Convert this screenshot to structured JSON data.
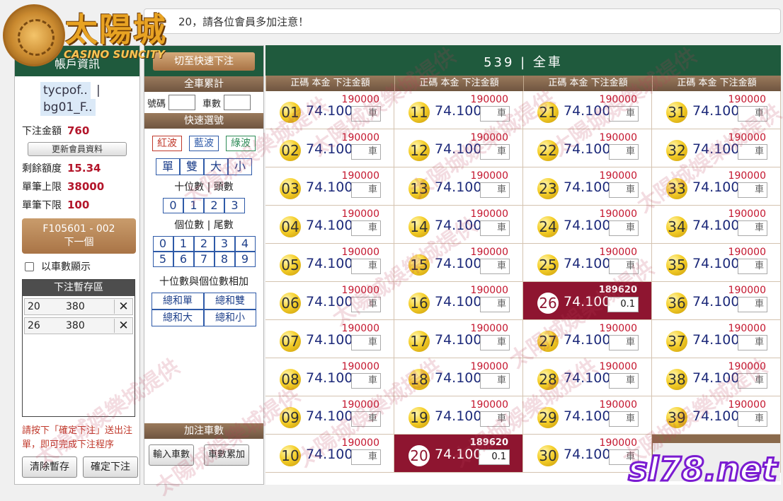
{
  "marquee": {
    "text": "20，請各位會員多加注意！"
  },
  "logo": {
    "title": "太陽城",
    "subtitle": "CASINO SUNCITY"
  },
  "account": {
    "header": "帳戶資訊",
    "user": "tycpof..",
    "sub": "bg01_F..",
    "bet_amount_label": "下注金額",
    "bet_amount": "760",
    "update_button": "更新會員資料",
    "balance_label": "剩餘額度",
    "balance": "15.34",
    "max_label": "單筆上限",
    "max": "38000",
    "min_label": "單筆下限",
    "min": "100",
    "next_button_line1": "F105601 - 002",
    "next_button_line2": "下一個",
    "show_by_car": "以車數顯示",
    "temp_header": "下注暫存區",
    "temp_items": [
      {
        "num": "20",
        "amount": "380"
      },
      {
        "num": "26",
        "amount": "380"
      }
    ],
    "note": "請按下「確定下注」送出注單，即可完成下注程序",
    "clear_button": "清除暫存",
    "confirm_button": "確定下注"
  },
  "quick": {
    "switch_button": "切至快速下注",
    "total_header": "全車累計",
    "num_label": "號碼",
    "count_label": "車數",
    "quick_header": "快速選號",
    "waves": [
      "紅波",
      "藍波",
      "綠波"
    ],
    "wave_colors": [
      "#c0392b",
      "#2e5aa8",
      "#2e8b57"
    ],
    "parity": [
      "單",
      "雙",
      "大",
      "小"
    ],
    "tens_label": "十位數 | 頭數",
    "tens": [
      "0",
      "1",
      "2",
      "3"
    ],
    "units_label": "個位數 | 尾數",
    "units_row1": [
      "0",
      "1",
      "2",
      "3",
      "4"
    ],
    "units_row2": [
      "5",
      "6",
      "7",
      "8",
      "9"
    ],
    "sum_label": "十位數與個位數相加",
    "sum_options": [
      "總和單",
      "總和雙",
      "總和大",
      "總和小"
    ],
    "add_header": "加注車數",
    "input_count_button": "輸入車數",
    "accumulate_button": "車數累加"
  },
  "board": {
    "title": "539 | 全車",
    "col_header": "正碼 本金 下注金額",
    "odds": "74.100",
    "limit": "190000",
    "input_placeholder": "車",
    "hot": {
      "20": {
        "limit": "189620",
        "value": "0.1"
      },
      "26": {
        "limit": "189620",
        "value": "0.1"
      }
    },
    "hot_color": "#8e1530"
  },
  "watermark": {
    "text": "太陽城娛樂城提供"
  },
  "brand": {
    "text": "sl78.net"
  }
}
